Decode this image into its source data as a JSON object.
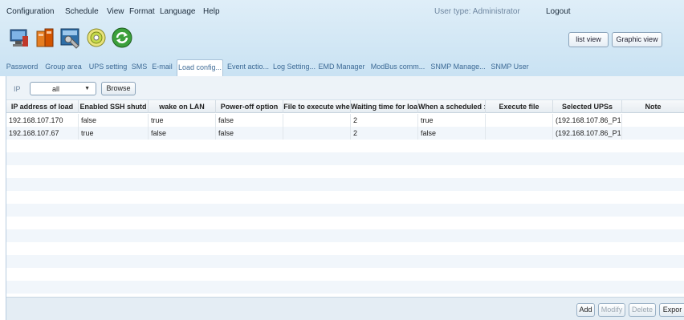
{
  "menu": [
    "Configuration",
    "Schedule",
    "View",
    "Format",
    "Language",
    "Help"
  ],
  "user_type": "User type: Administrator",
  "logout": "Logout",
  "toolbar_icons": [
    "monitor-icon",
    "ups-icon",
    "settings-tool-icon",
    "disc-icon",
    "refresh-icon"
  ],
  "view_buttons": {
    "list": "list view",
    "graphic": "Graphic view"
  },
  "tabs": [
    "Password",
    "Group area",
    "UPS setting",
    "SMS",
    "E-mail",
    "Load config...",
    "Event actio...",
    "Log Setting...",
    "EMD Manager",
    "ModBus comm...",
    "SNMP Manage...",
    "SNMP User"
  ],
  "active_tab": "Load config...",
  "filter": {
    "label": "IP",
    "selected": "all",
    "browse": "Browse"
  },
  "table": {
    "columns": [
      "IP address of load",
      "Enabled SSH shutd",
      "wake on LAN",
      "Power-off option",
      "File to execute whe",
      "Waiting time for loa",
      "When a scheduled :",
      "Execute file",
      "Selected UPSs",
      "Note"
    ],
    "rows": [
      [
        "192.168.107.170",
        "false",
        "true",
        "false",
        "",
        "2",
        "true",
        "",
        "(192.168.107.86_P1(",
        ""
      ],
      [
        "192.168.107.67",
        "true",
        "false",
        "false",
        "",
        "2",
        "false",
        "",
        "(192.168.107.86_P1(",
        ""
      ]
    ]
  },
  "actions": {
    "add": "Add",
    "modify": "Modify",
    "delete": "Delete",
    "export": "Expor"
  },
  "colors": {
    "header_bg": "#c9e2f3",
    "tab_text": "#3d6a96",
    "alt_row": "#f1f6fb"
  }
}
